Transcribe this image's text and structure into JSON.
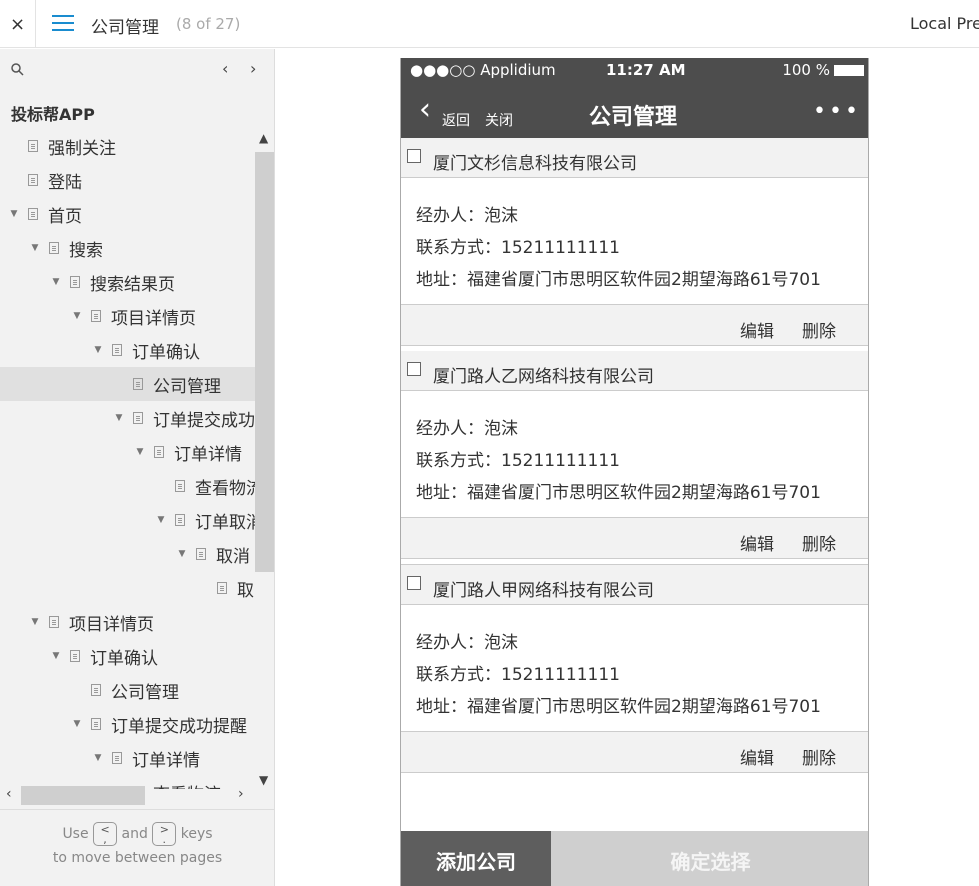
{
  "topbar": {
    "close_symbol": "×",
    "title": "公司管理",
    "count": "(8 of 27)",
    "right_label": "Local Preview"
  },
  "sidebar": {
    "app_name": "投标帮APP",
    "prev_symbol": "‹",
    "next_symbol": "›",
    "tree": [
      {
        "label": "强制关注",
        "indent": 0,
        "arrow": false,
        "selected": false
      },
      {
        "label": "登陆",
        "indent": 0,
        "arrow": false,
        "selected": false
      },
      {
        "label": "首页",
        "indent": 0,
        "arrow": true,
        "selected": false
      },
      {
        "label": "搜索",
        "indent": 1,
        "arrow": true,
        "selected": false
      },
      {
        "label": "搜索结果页",
        "indent": 2,
        "arrow": true,
        "selected": false
      },
      {
        "label": "项目详情页",
        "indent": 3,
        "arrow": true,
        "selected": false
      },
      {
        "label": "订单确认",
        "indent": 4,
        "arrow": true,
        "selected": false
      },
      {
        "label": "公司管理",
        "indent": 5,
        "arrow": false,
        "selected": true
      },
      {
        "label": "订单提交成功提醒",
        "indent": 5,
        "arrow": true,
        "selected": false
      },
      {
        "label": "订单详情",
        "indent": 6,
        "arrow": true,
        "selected": false
      },
      {
        "label": "查看物流",
        "indent": 7,
        "arrow": false,
        "selected": false
      },
      {
        "label": "订单取消",
        "indent": 7,
        "arrow": true,
        "selected": false
      },
      {
        "label": "取消",
        "indent": 8,
        "arrow": true,
        "selected": false
      },
      {
        "label": "取",
        "indent": 9,
        "arrow": false,
        "selected": false
      },
      {
        "label": "项目详情页",
        "indent": 1,
        "arrow": true,
        "selected": false
      },
      {
        "label": "订单确认",
        "indent": 2,
        "arrow": true,
        "selected": false
      },
      {
        "label": "公司管理",
        "indent": 3,
        "arrow": false,
        "selected": false
      },
      {
        "label": "订单提交成功提醒",
        "indent": 3,
        "arrow": true,
        "selected": false
      },
      {
        "label": "订单详情",
        "indent": 4,
        "arrow": true,
        "selected": false
      },
      {
        "label": "查看物流",
        "indent": 5,
        "arrow": false,
        "selected": false
      }
    ],
    "hint_use": "Use",
    "hint_and": "and",
    "hint_keys": "keys",
    "hint_line2": "to move between pages",
    "key_prev": "<\n,",
    "key_next": ">\n."
  },
  "phone": {
    "status": {
      "carrier": "●●●○○ Applidium ",
      "time": "11:27 AM",
      "battery": "100 %"
    },
    "nav": {
      "back_symbol": "‹",
      "back_label": "返回",
      "close_label": "关闭",
      "title": "公司管理",
      "more": "•••"
    },
    "companies": [
      {
        "name": "厦门文杉信息科技有限公司",
        "agent": "经办人：泡沫",
        "contact": "联系方式：15211111111",
        "address": "地址：福建省厦门市思明区软件园2期望海路61号701",
        "edit": "编辑",
        "delete": "删除"
      },
      {
        "name": "厦门路人乙网络科技有限公司",
        "agent": "经办人：泡沫",
        "contact": "联系方式：15211111111",
        "address": "地址：福建省厦门市思明区软件园2期望海路61号701",
        "edit": "编辑",
        "delete": "删除"
      },
      {
        "name": "厦门路人甲网络科技有限公司",
        "agent": "经办人：泡沫",
        "contact": "联系方式：15211111111",
        "address": "地址：福建省厦门市思明区软件园2期望海路61号701",
        "edit": "编辑",
        "delete": "删除"
      }
    ],
    "footer": {
      "add": "添加公司",
      "confirm": "确定选择"
    }
  }
}
